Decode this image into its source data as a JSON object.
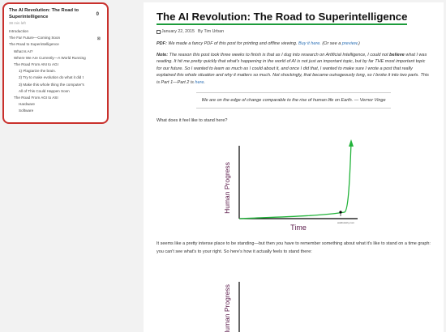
{
  "toc": {
    "title": "The AI Revolution: The Road to Superintelligence",
    "count": "0",
    "read_time": "38 min left",
    "items": [
      {
        "label": "Introduction",
        "level": 1
      },
      {
        "label": "The Far Future—Coming Soon",
        "level": 1,
        "bookmark": true
      },
      {
        "label": "The Road to Superintelligence",
        "level": 1
      },
      {
        "label": "What Is AI?",
        "level": 2
      },
      {
        "label": "Where We Are Currently—A World Running",
        "level": 2
      },
      {
        "label": "The Road From ANI to AGI",
        "level": 2
      },
      {
        "label": "1) Plagiarize the brain.",
        "level": 3
      },
      {
        "label": "2) Try to make evolution do what it did t",
        "level": 3
      },
      {
        "label": "3) Make this whole thing the computer's",
        "level": 3
      },
      {
        "label": "All of This Could Happen Soon",
        "level": 3
      },
      {
        "label": "The Road From AGI to ASI",
        "level": 2
      },
      {
        "label": "Hardware",
        "level": 3
      },
      {
        "label": "Software",
        "level": 3
      }
    ],
    "bookmark_glyph": "⊠"
  },
  "article": {
    "title": "The AI Revolution: The Road to Superintelligence",
    "date": "January 22, 2015",
    "author": "By Tim Urban",
    "pdf_label": "PDF:",
    "pdf_text": " We made a fancy PDF of this post for printing and offline viewing. ",
    "pdf_link": "Buy it here.",
    "pdf_or": " (Or see a ",
    "pdf_preview": "preview",
    "pdf_end": ".)",
    "note_label": "Note:",
    "note_text1": " The reason this post took three weeks to finish is that as I dug into research on Artificial Intelligence, I could not ",
    "note_believe": "believe",
    "note_text2": " what I was reading. It hit me pretty quickly that what's happening in the world of AI is not just an important topic, but by far THE most important topic for our future. So I wanted to learn as much as I could about it, and once I did that, I wanted to make sure I wrote a post that really explained this whole situation and why it matters so much. Not shockingly, that became outrageously long, so I broke it into two parts. This is Part 1—Part 2 is ",
    "note_link": "here",
    "note_end": ".",
    "quote": "We are on the edge of change comparable to the rise of human life on Earth. — Vernor Vinge",
    "question": "What does it feel like to stand here?",
    "graph_ylabel": "Human Progress",
    "graph_xlabel": "Time",
    "graph_watermark": "waitbutwhy.com",
    "para2": "It seems like a pretty intense place to be standing—but then you have to remember something about what it's like to stand on a time graph: you can't see what's to your right. So here's how it actually feels to stand there:",
    "graph2_ylabel": "Human Progress"
  },
  "colors": {
    "accent_red": "#c9302c",
    "title_underline": "#1d9b3b",
    "graph_line": "#22b33a",
    "graph_label": "#5a1a4a",
    "link": "#2a6fb5"
  }
}
